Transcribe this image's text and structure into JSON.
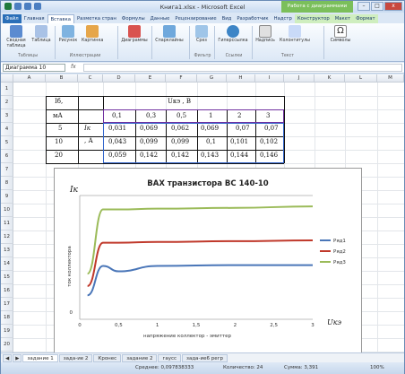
{
  "window": {
    "title": "Книга1.xlsx - Microsoft Excel",
    "contextual_label": "Работа с диаграммами",
    "controls": [
      "–",
      "□",
      "x"
    ]
  },
  "tabs": [
    "Файл",
    "Главная",
    "Вставка",
    "Разметка стран",
    "Формулы",
    "Данные",
    "Рецензирование",
    "Вид",
    "Разработчик",
    "Надстр",
    "Конструктор",
    "Макет",
    "Формат"
  ],
  "ribbon": {
    "buttons": [
      "Сводная таблица",
      "Таблица",
      "Рисунок",
      "Картинка",
      "Диаграммы",
      "Спарклайны",
      "Срез",
      "Гиперссылка",
      "Надпись",
      "Колонтитулы",
      "Символы"
    ],
    "groups": [
      "Таблицы",
      "Иллюстрации",
      "Фильтр",
      "Ссылки",
      "Текст"
    ]
  },
  "formula_bar": {
    "name_box": "Диаграмма 10",
    "fx": "fx",
    "value": ""
  },
  "sheet": {
    "columns": [
      "A",
      "B",
      "C",
      "D",
      "E",
      "F",
      "G",
      "H",
      "I",
      "J",
      "K",
      "L",
      "M"
    ],
    "rows": [
      "1",
      "2",
      "3",
      "4",
      "5",
      "6",
      "7",
      "8",
      "9",
      "10",
      "11",
      "12",
      "13",
      "14",
      "15",
      "16",
      "17",
      "18",
      "19",
      "20",
      "21",
      "22",
      "23",
      "24",
      "25",
      "26",
      "27",
      "28",
      "29",
      "30"
    ]
  },
  "table": {
    "ib_label": "Iб,",
    "ma_label": "мА",
    "uke_label": "Uкэ , В",
    "ik_label": "Iк",
    "a_label": ", А",
    "voltages": [
      "0,1",
      "0,3",
      "0,5",
      "1",
      "2",
      "3"
    ],
    "rows": [
      {
        "ib": "5",
        "values": [
          "0,031",
          "0,069",
          "0,062",
          "0,069",
          "0,07",
          "0,07"
        ]
      },
      {
        "ib": "10",
        "values": [
          "0,043",
          "0,099",
          "0,099",
          "0,1",
          "0,101",
          "0,102"
        ]
      },
      {
        "ib": "20",
        "values": [
          "0,059",
          "0,142",
          "0,142",
          "0,143",
          "0,144",
          "0,146"
        ]
      }
    ]
  },
  "chart_data": {
    "type": "line",
    "title": "ВАХ транзистора ВС 140-10",
    "xlabel": "напряжение коллектор - эмиттер",
    "ylabel": "ток коллектора",
    "x_annotation": "Uкэ",
    "y_annotation": "Iк",
    "x": [
      0.1,
      0.3,
      0.5,
      1,
      2,
      3
    ],
    "xlim": [
      0,
      3
    ],
    "ylim": [
      0,
      0.16
    ],
    "x_ticks": [
      "0",
      "0,5",
      "1",
      "1,5",
      "2",
      "2,5",
      "3"
    ],
    "y_ticks": [
      "0"
    ],
    "grid": true,
    "legend": "right",
    "series": [
      {
        "name": "Ряд1",
        "values": [
          0.031,
          0.069,
          0.062,
          0.069,
          0.07,
          0.07
        ],
        "color": "#4a76b8"
      },
      {
        "name": "Ряд2",
        "values": [
          0.043,
          0.099,
          0.099,
          0.1,
          0.101,
          0.102
        ],
        "color": "#c0392b"
      },
      {
        "name": "Ряд3",
        "values": [
          0.059,
          0.142,
          0.142,
          0.143,
          0.144,
          0.146
        ],
        "color": "#9bbb59"
      }
    ]
  },
  "sheet_tabs": [
    "задание 1",
    "зада-ие 2",
    "Кронес",
    "задание 2",
    "гаусс",
    "зада-ие6 регр"
  ],
  "status": {
    "average": "Среднее: 0,097838333",
    "count": "Количество: 24",
    "sum": "Сумма: 3,391",
    "zoom": "100%"
  }
}
